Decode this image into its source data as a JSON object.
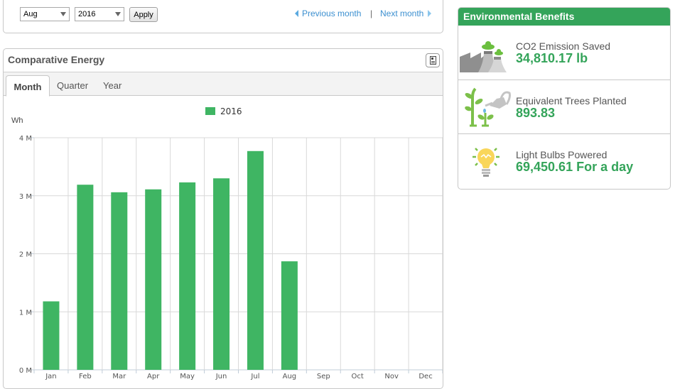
{
  "filter": {
    "month_selected": "Aug",
    "year_selected": "2016",
    "apply_label": "Apply",
    "previous_label": "Previous month",
    "separator": "|",
    "next_label": "Next month"
  },
  "energy_panel": {
    "title": "Comparative Energy",
    "export_icon": "export-report-icon",
    "tabs": [
      {
        "label": "Month",
        "active": true
      },
      {
        "label": "Quarter",
        "active": false
      },
      {
        "label": "Year",
        "active": false
      }
    ]
  },
  "chart_data": {
    "type": "bar",
    "title": "",
    "xlabel": "",
    "ylabel": "Wh",
    "categories": [
      "Jan",
      "Feb",
      "Mar",
      "Apr",
      "May",
      "Jun",
      "Jul",
      "Aug",
      "Sep",
      "Oct",
      "Nov",
      "Dec"
    ],
    "series": [
      {
        "name": "2016",
        "color": "#3fb563",
        "values": [
          1180000,
          3190000,
          3060000,
          3110000,
          3230000,
          3300000,
          3770000,
          1870000,
          null,
          null,
          null,
          null
        ]
      }
    ],
    "ylim": [
      0,
      4000000
    ],
    "yticks": [
      0,
      1000000,
      2000000,
      3000000,
      4000000
    ],
    "ytick_labels": [
      "0 M",
      "1 M",
      "2 M",
      "3 M",
      "4 M"
    ],
    "grid": true,
    "legend": "top-center"
  },
  "environmental_benefits": {
    "title": "Environmental Benefits",
    "header_color": "#34a45a",
    "value_color": "#34a45a",
    "items": [
      {
        "icon": "factory-emission-icon",
        "label": "CO2 Emission Saved",
        "value": "34,810.17 lb"
      },
      {
        "icon": "tree-watering-icon",
        "label": "Equivalent Trees Planted",
        "value": "893.83"
      },
      {
        "icon": "light-bulb-icon",
        "label": "Light Bulbs Powered",
        "value": "69,450.61 For a day"
      }
    ]
  }
}
